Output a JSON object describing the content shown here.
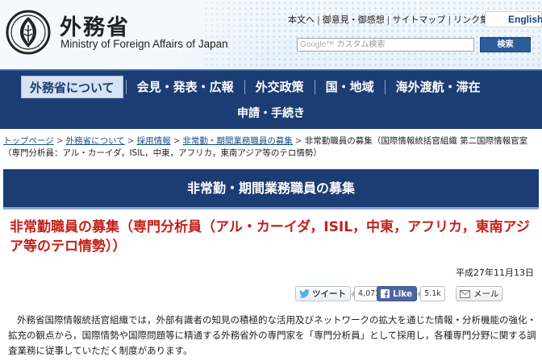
{
  "header": {
    "site_name_ja": "外務省",
    "site_name_en": "Ministry of Foreign Affairs of Japan",
    "util_links": [
      "本文へ",
      "御意見・御感想",
      "サイトマップ",
      "リンク集"
    ],
    "language_button": "English",
    "search_brand": "Google™",
    "search_placeholder": "カスタム検索",
    "search_button": "検索",
    "colors": {
      "header_bg": "#eef5fb",
      "nav_bg": "#1c3d74",
      "heading_red": "#c2221b"
    }
  },
  "nav": {
    "items": [
      {
        "label": "外務省について",
        "active": true
      },
      {
        "label": "会見・発表・広報",
        "active": false
      },
      {
        "label": "外交政策",
        "active": false
      },
      {
        "label": "国・地域",
        "active": false
      },
      {
        "label": "海外渡航・滞在",
        "active": false
      }
    ],
    "row2": [
      {
        "label": "申請・手続き"
      }
    ]
  },
  "breadcrumb": {
    "links": [
      "トップページ",
      "外務省について",
      "採用情報",
      "非常勤・期間業務職員の募集"
    ],
    "current": "非常勤職員の募集（国際情報統括官組織 第二国際情報官室（専門分析員：アル・カーイダ，ISIL，中東，アフリカ，東南アジア等のテロ情勢）"
  },
  "section_title": "非常勤・期間業務職員の募集",
  "main_heading": "非常勤職員の募集（専門分析員（アル・カーイダ，ISIL，中東，アフリカ，東南アジア等のテロ情勢））",
  "publish_date": "平成27年11月13日",
  "share": {
    "tweet_label": "ツイート",
    "tweet_count": "4,073",
    "like_label": "Like",
    "like_count": "5.1k",
    "mail_label": "メール",
    "icons": {
      "twitter": "twitter-bird-icon",
      "facebook": "facebook-f-icon",
      "mail": "envelope-icon"
    }
  },
  "intro_text": "外務省国際情報統括官組織では，外部有識者の知見の積極的な活用及びネットワークの拡大を通じた情報・分析機能の強化・拡充の観点から，国際情勢や国際問題等に精通する外務省外の専門家を「専門分析員」として採用し，各種専門分野に関する調査業務に従事していただく制度があります。"
}
